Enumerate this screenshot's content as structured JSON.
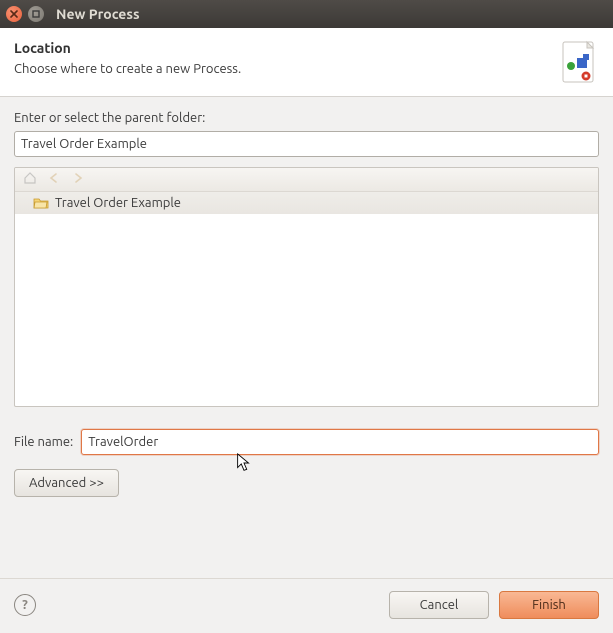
{
  "window": {
    "title": "New Process"
  },
  "header": {
    "title": "Location",
    "subtitle": "Choose where to create a new Process."
  },
  "body": {
    "parent_folder_label": "Enter or select the parent folder:",
    "parent_folder_value": "Travel Order Example",
    "tree": {
      "items": [
        {
          "label": "Travel Order Example",
          "selected": true
        }
      ]
    },
    "filename_label": "File name:",
    "filename_value": "TravelOrder",
    "advanced_label": "Advanced >>"
  },
  "footer": {
    "cancel_label": "Cancel",
    "finish_label": "Finish"
  }
}
